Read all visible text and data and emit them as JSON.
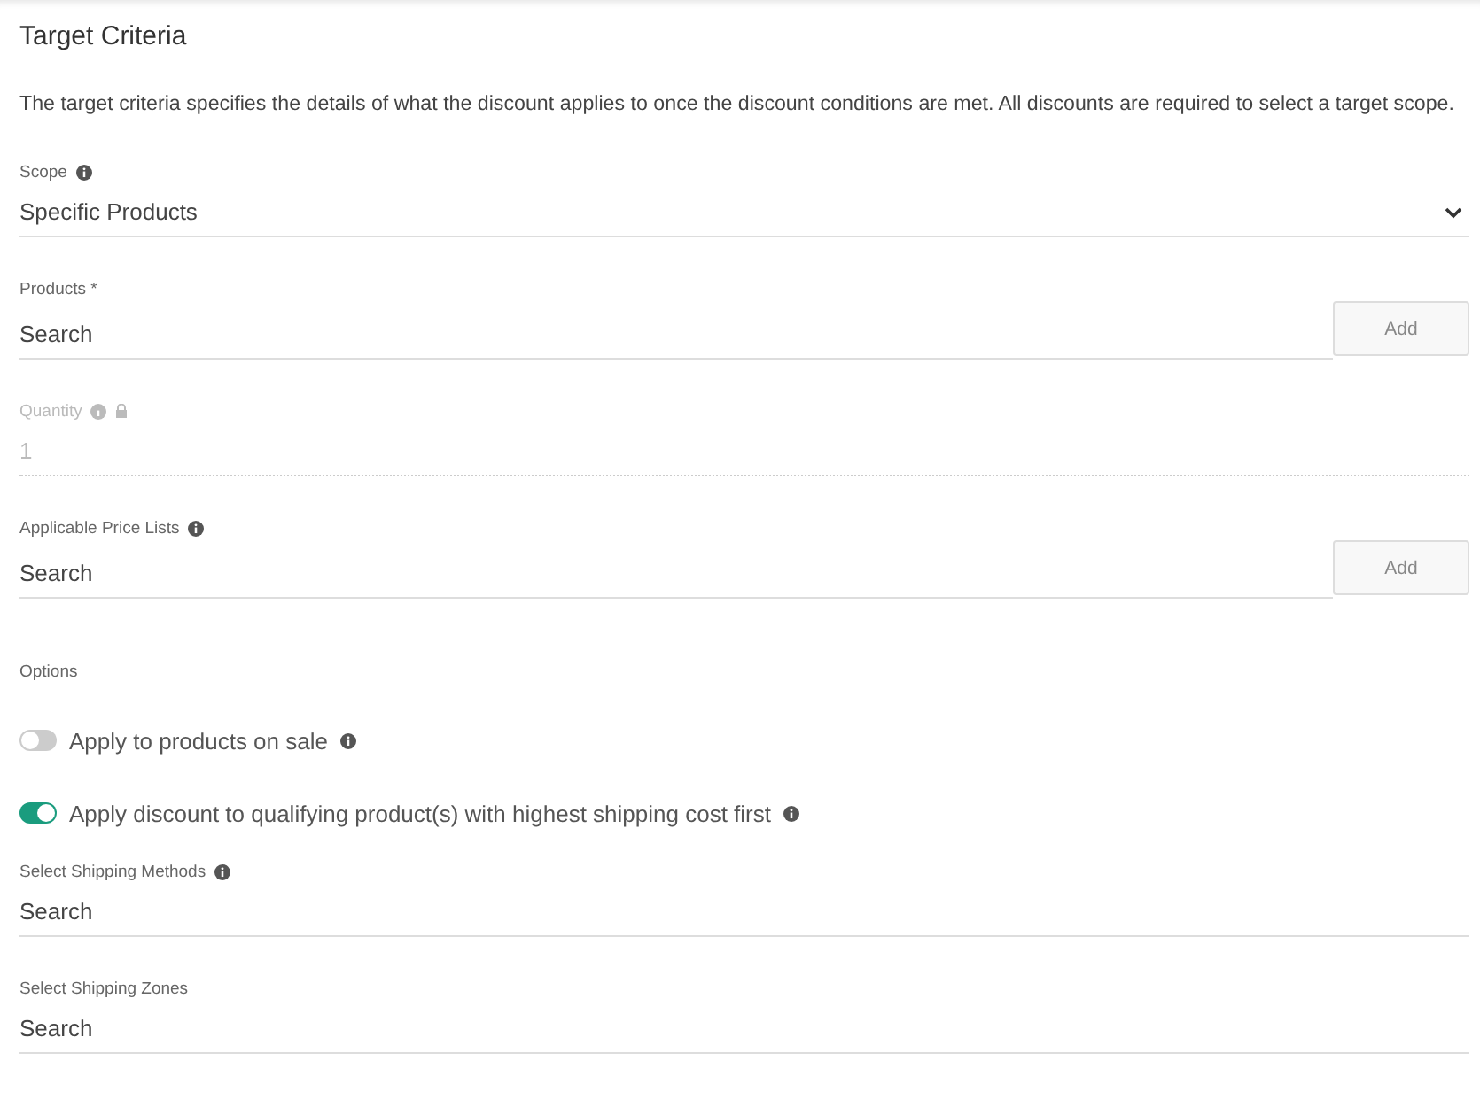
{
  "title": "Target Criteria",
  "description": "The target criteria specifies the details of what the discount applies to once the discount conditions are met. All discounts are required to select a target scope.",
  "items": [
    {
      "kind": "select",
      "label": "Scope",
      "info": true,
      "value": "Specific Products"
    },
    {
      "kind": "search",
      "label": "Products *",
      "info": false,
      "placeholder": "Search",
      "button": "Add"
    },
    {
      "kind": "input",
      "label": "Quantity",
      "info": true,
      "locked": true,
      "disabled": true,
      "value": "1"
    },
    {
      "kind": "search",
      "label": "Applicable Price Lists",
      "info": true,
      "placeholder": "Search",
      "button": "Add"
    },
    {
      "kind": "heading",
      "label": "Options"
    },
    {
      "kind": "toggle",
      "label": "Apply to products on sale",
      "info": true,
      "on": false
    },
    {
      "kind": "toggle",
      "label": "Apply discount to qualifying product(s) with highest shipping cost first",
      "info": true,
      "on": true
    },
    {
      "kind": "search",
      "label": "Select Shipping Methods",
      "info": true,
      "placeholder": "Search"
    },
    {
      "kind": "search",
      "label": "Select Shipping Zones",
      "info": false,
      "placeholder": "Search"
    }
  ]
}
